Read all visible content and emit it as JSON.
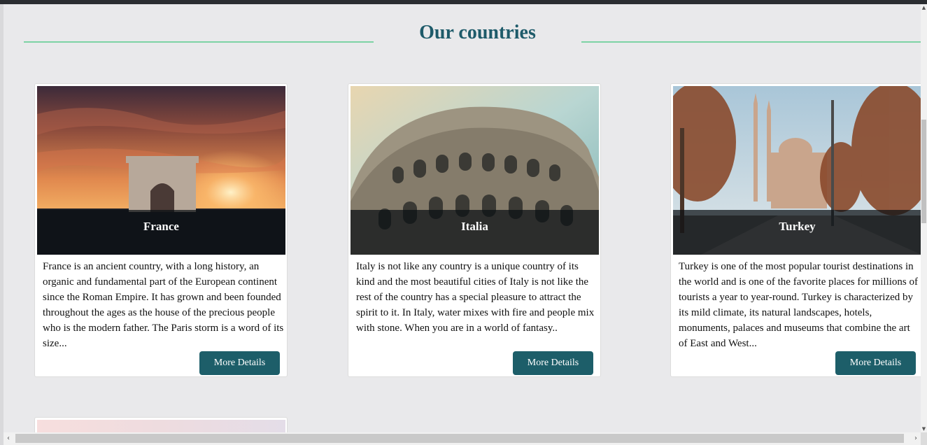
{
  "section": {
    "title": "Our countries",
    "line_color": "#7dd3a4",
    "title_color": "#1e5b6a"
  },
  "cards": [
    {
      "name": "France",
      "description": "France is an ancient country, with a long history, an organic and fundamental part of the European continent since the Roman Empire. It has grown and been founded throughout the ages as the house of the precious people who is the modern father. The Paris storm is a word of its size...",
      "button": "More Details",
      "image": "arc-de-triomphe-sunset"
    },
    {
      "name": "Italia",
      "description": "Italy is not like any country is a unique country of its kind and the most beautiful cities of Italy is not like the rest of the country has a special pleasure to attract the spirit to it. In Italy, water mixes with fire and people mix with stone. When you are in a world of fantasy..",
      "button": "More Details",
      "image": "colosseum"
    },
    {
      "name": "Turkey",
      "description": "Turkey is one of the most popular tourist destinations in the world and is one of the favorite places for millions of tourists a year to year-round. Turkey is characterized by its mild climate, its natural landscapes, hotels, monuments, palaces and museums that combine the art of East and West...",
      "button": "More Details",
      "image": "mosque-street-autumn"
    }
  ],
  "button_color": "#1d5e69",
  "icons": {
    "scroll_up": "scroll-up-arrow-icon",
    "scroll_down": "scroll-down-arrow-icon",
    "scroll_left": "scroll-left-arrow-icon",
    "scroll_right": "scroll-right-arrow-icon"
  }
}
